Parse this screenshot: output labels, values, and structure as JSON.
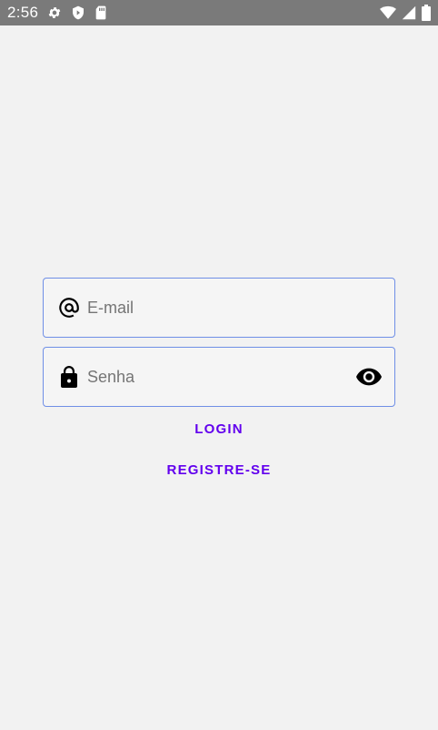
{
  "status_bar": {
    "time": "2:56",
    "left_icons": [
      "gear-icon",
      "shield-icon",
      "sd-card-icon"
    ],
    "right_icons": [
      "wifi-icon",
      "signal-icon",
      "battery-icon"
    ],
    "background": "#7a7a7a"
  },
  "login_form": {
    "email": {
      "placeholder": "E-mail",
      "value": "",
      "icon": "at-sign-icon"
    },
    "password": {
      "placeholder": "Senha",
      "value": "",
      "icon": "lock-icon",
      "toggle_icon": "eye-icon"
    },
    "login_label": "LOGIN",
    "register_label": "REGISTRE-SE",
    "accent_color": "#6200ee",
    "field_border_color": "#6f8fe6"
  }
}
